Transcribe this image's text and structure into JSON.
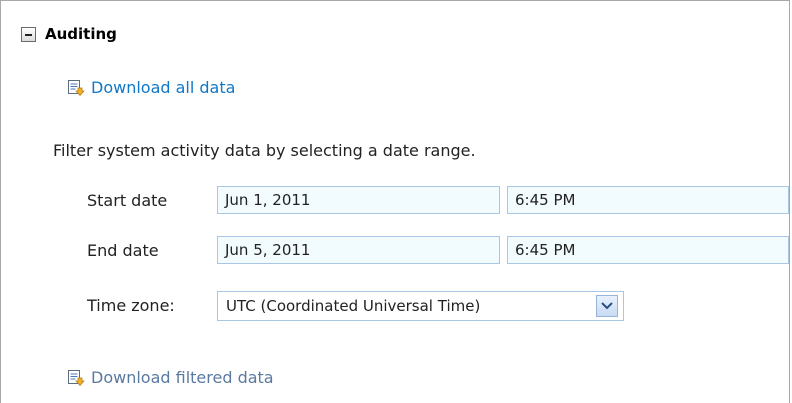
{
  "section": {
    "title": "Auditing",
    "toggle_icon": "collapse-minus-icon"
  },
  "links": {
    "download_all": "Download all data",
    "download_filtered": "Download filtered data",
    "icon": "document-download-icon"
  },
  "filter": {
    "intro": "Filter system activity data by selecting a date range.",
    "start_label": "Start date",
    "start_date": "Jun 1, 2011",
    "start_time": "6:45 PM",
    "end_label": "End date",
    "end_date": "Jun 5, 2011",
    "end_time": "6:45 PM",
    "timezone_label": "Time zone:",
    "timezone_value": "UTC (Coordinated Universal Time)"
  },
  "colors": {
    "link_primary": "#0f78c8",
    "link_secondary": "#5a7aa0",
    "field_border": "#a9c6e3",
    "field_bg": "#f2fbfe"
  }
}
